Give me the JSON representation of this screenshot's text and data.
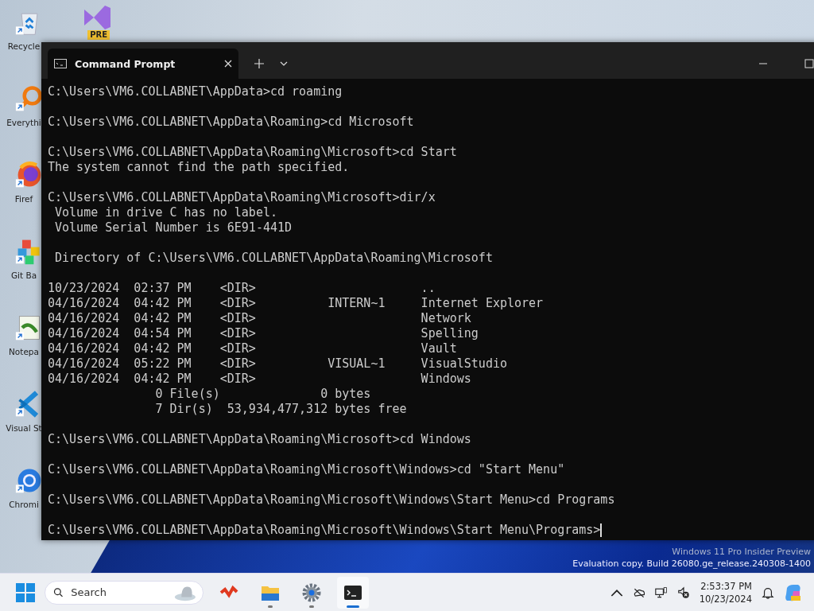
{
  "desktop_icons": [
    {
      "kind": "recycle",
      "label": "Recycle"
    },
    {
      "kind": "search-app",
      "label": "Everythi"
    },
    {
      "kind": "browser-fox",
      "label": "Firef"
    },
    {
      "kind": "diamond",
      "label": "Git Ba"
    },
    {
      "kind": "notepad",
      "label": "Notepa"
    },
    {
      "kind": "code",
      "label": "Visual St"
    },
    {
      "kind": "chrome",
      "label": "Chromi"
    }
  ],
  "pinned_icon": {
    "badge": "PRE"
  },
  "window": {
    "tabs": [
      {
        "title": "Command Prompt",
        "selected": true
      }
    ]
  },
  "terminal": {
    "blocks": [
      [
        "C:\\Users\\VM6.COLLABNET\\AppData>cd roaming"
      ],
      [
        "C:\\Users\\VM6.COLLABNET\\AppData\\Roaming>cd Microsoft"
      ],
      [
        "C:\\Users\\VM6.COLLABNET\\AppData\\Roaming\\Microsoft>cd Start",
        "The system cannot find the path specified."
      ],
      [
        "C:\\Users\\VM6.COLLABNET\\AppData\\Roaming\\Microsoft>dir/x",
        " Volume in drive C has no label.",
        " Volume Serial Number is 6E91-441D"
      ],
      [
        " Directory of C:\\Users\\VM6.COLLABNET\\AppData\\Roaming\\Microsoft"
      ],
      [
        "10/23/2024  02:37 PM    <DIR>                       ..",
        "04/16/2024  04:42 PM    <DIR>          INTERN~1     Internet Explorer",
        "04/16/2024  04:42 PM    <DIR>                       Network",
        "04/16/2024  04:54 PM    <DIR>                       Spelling",
        "04/16/2024  04:42 PM    <DIR>                       Vault",
        "04/16/2024  05:22 PM    <DIR>          VISUAL~1     VisualStudio",
        "04/16/2024  04:42 PM    <DIR>                       Windows",
        "               0 File(s)              0 bytes",
        "               7 Dir(s)  53,934,477,312 bytes free"
      ],
      [
        "C:\\Users\\VM6.COLLABNET\\AppData\\Roaming\\Microsoft>cd Windows"
      ],
      [
        "C:\\Users\\VM6.COLLABNET\\AppData\\Roaming\\Microsoft\\Windows>cd \"Start Menu\""
      ],
      [
        "C:\\Users\\VM6.COLLABNET\\AppData\\Roaming\\Microsoft\\Windows\\Start Menu>cd Programs"
      ],
      [
        "C:\\Users\\VM6.COLLABNET\\AppData\\Roaming\\Microsoft\\Windows\\Start Menu\\Programs>"
      ]
    ]
  },
  "evaluation_notice": [
    "Windows 11 Pro Insider Preview",
    "Evaluation copy. Build 26080.ge_release.240308-1400"
  ],
  "taskbar": {
    "search": {
      "placeholder": "Search"
    },
    "apps": [
      {
        "kind": "squiggle",
        "running": false,
        "active": false
      },
      {
        "kind": "folder",
        "running": true,
        "active": false
      },
      {
        "kind": "gear",
        "running": true,
        "active": false
      },
      {
        "kind": "terminal",
        "running": false,
        "active": true
      }
    ],
    "time": "2:53:37 PM",
    "date": "10/23/2024"
  }
}
